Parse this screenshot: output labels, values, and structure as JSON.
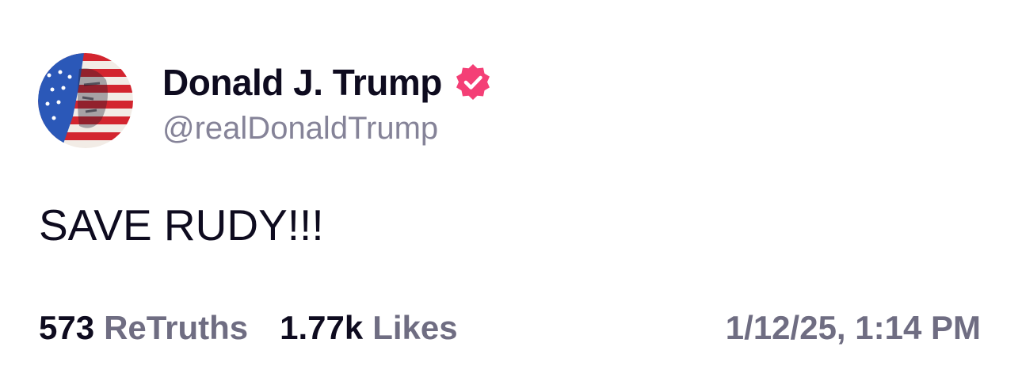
{
  "author": {
    "display_name": "Donald J. Trump",
    "handle": "@realDonaldTrump",
    "verified": true,
    "verified_color": "#f43f76",
    "avatar_icon": "flag-portrait-avatar"
  },
  "post": {
    "text": "SAVE RUDY!!!"
  },
  "stats": {
    "retruths_count": "573",
    "retruths_label": "ReTruths",
    "likes_count": "1.77k",
    "likes_label": "Likes"
  },
  "timestamp": "1/12/25, 1:14 PM",
  "colors": {
    "text_primary": "#0e0b1f",
    "text_secondary": "#6f6d82"
  }
}
